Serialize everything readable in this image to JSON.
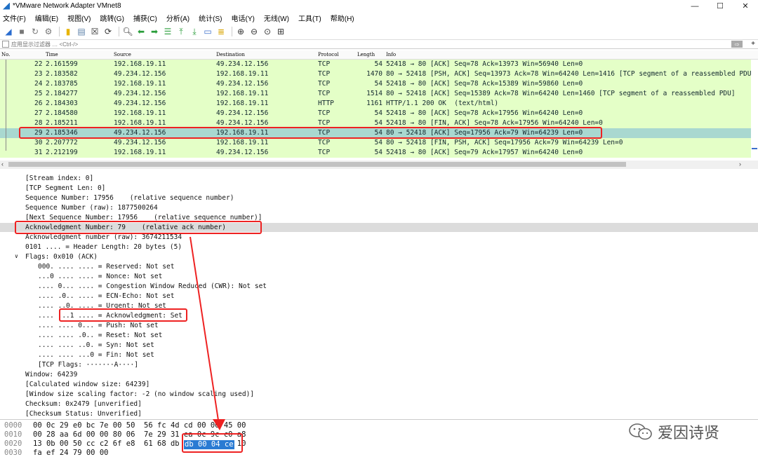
{
  "window": {
    "title": "*VMware Network Adapter VMnet8",
    "minimize": "—",
    "maximize": "☐",
    "close": "✕"
  },
  "menu": [
    "文件(F)",
    "编辑(E)",
    "视图(V)",
    "跳转(G)",
    "捕获(C)",
    "分析(A)",
    "统计(S)",
    "电话(Y)",
    "无线(W)",
    "工具(T)",
    "帮助(H)"
  ],
  "filter": {
    "placeholder": "应用显示过滤器 … <Ctrl-/>"
  },
  "columns": {
    "no": "No.",
    "time": "Time",
    "source": "Source",
    "destination": "Destination",
    "protocol": "Protocol",
    "length": "Length",
    "info": "Info"
  },
  "packets": [
    {
      "no": "22",
      "time": "2.161599",
      "src": "192.168.19.11",
      "dst": "49.234.12.156",
      "proto": "TCP",
      "len": "54",
      "info": "52418 → 80 [ACK] Seq=78 Ack=13973 Win=56940 Len=0"
    },
    {
      "no": "23",
      "time": "2.183582",
      "src": "49.234.12.156",
      "dst": "192.168.19.11",
      "proto": "TCP",
      "len": "1470",
      "info": "80 → 52418 [PSH, ACK] Seq=13973 Ack=78 Win=64240 Len=1416 [TCP segment of a reassembled PDU"
    },
    {
      "no": "24",
      "time": "2.183785",
      "src": "192.168.19.11",
      "dst": "49.234.12.156",
      "proto": "TCP",
      "len": "54",
      "info": "52418 → 80 [ACK] Seq=78 Ack=15389 Win=59860 Len=0"
    },
    {
      "no": "25",
      "time": "2.184277",
      "src": "49.234.12.156",
      "dst": "192.168.19.11",
      "proto": "TCP",
      "len": "1514",
      "info": "80 → 52418 [ACK] Seq=15389 Ack=78 Win=64240 Len=1460 [TCP segment of a reassembled PDU]"
    },
    {
      "no": "26",
      "time": "2.184303",
      "src": "49.234.12.156",
      "dst": "192.168.19.11",
      "proto": "HTTP",
      "len": "1161",
      "info": "HTTP/1.1 200 OK  (text/html)"
    },
    {
      "no": "27",
      "time": "2.184580",
      "src": "192.168.19.11",
      "dst": "49.234.12.156",
      "proto": "TCP",
      "len": "54",
      "info": "52418 → 80 [ACK] Seq=78 Ack=17956 Win=64240 Len=0"
    },
    {
      "no": "28",
      "time": "2.185211",
      "src": "192.168.19.11",
      "dst": "49.234.12.156",
      "proto": "TCP",
      "len": "54",
      "info": "52418 → 80 [FIN, ACK] Seq=78 Ack=17956 Win=64240 Len=0"
    },
    {
      "no": "29",
      "time": "2.185346",
      "src": "49.234.12.156",
      "dst": "192.168.19.11",
      "proto": "TCP",
      "len": "54",
      "info": "80 → 52418 [ACK] Seq=17956 Ack=79 Win=64239 Len=0"
    },
    {
      "no": "30",
      "time": "2.207772",
      "src": "49.234.12.156",
      "dst": "192.168.19.11",
      "proto": "TCP",
      "len": "54",
      "info": "80 → 52418 [FIN, PSH, ACK] Seq=17956 Ack=79 Win=64239 Len=0"
    },
    {
      "no": "31",
      "time": "2.212199",
      "src": "192.168.19.11",
      "dst": "49.234.12.156",
      "proto": "TCP",
      "len": "54",
      "info": "52418 → 80 [ACK] Seq=79 Ack=17957 Win=64240 Len=0"
    }
  ],
  "selected_packet": "29",
  "details": [
    "[Stream index: 0]",
    "[TCP Segment Len: 0]",
    "Sequence Number: 17956    (relative sequence number)",
    "Sequence Number (raw): 1877500264",
    "[Next Sequence Number: 17956    (relative sequence number)]",
    "Acknowledgment Number: 79    (relative ack number)",
    "Acknowledgment number (raw): 3674211534",
    "0101 .... = Header Length: 20 bytes (5)",
    "Flags: 0x010 (ACK)",
    "000. .... .... = Reserved: Not set",
    "...0 .... .... = Nonce: Not set",
    ".... 0... .... = Congestion Window Reduced (CWR): Not set",
    ".... .0.. .... = ECN-Echo: Not set",
    ".... ..0. .... = Urgent: Not set",
    ".... ...1 .... = Acknowledgment: Set",
    ".... .... 0... = Push: Not set",
    ".... .... .0.. = Reset: Not set",
    ".... .... ..0. = Syn: Not set",
    ".... .... ...0 = Fin: Not set",
    "[TCP Flags: ·······A····]",
    "Window: 64239",
    "[Calculated window size: 64239]",
    "[Window size scaling factor: -2 (no window scaling used)]",
    "Checksum: 0x2479 [unverified]",
    "[Checksum Status: Unverified]"
  ],
  "bytes": [
    {
      "offset": "0000",
      "hex": "00 0c 29 e0 bc 7e 00 50  56 fc 4d cd 00 00 45 00"
    },
    {
      "offset": "0010",
      "hex": "00 28 aa 6d 00 00 80 06  7e 29 31 ea 0c 9c c0 a8"
    },
    {
      "offset": "0020",
      "hex": "13 0b 00 50 cc c2 6f e8  61 68 db 00 04 ce 50 10"
    },
    {
      "offset": "0030",
      "hex": "fa ef 24 79 00 00"
    }
  ],
  "bytes_selected": "db 00 04 ce",
  "watermark": "爱因诗贤"
}
